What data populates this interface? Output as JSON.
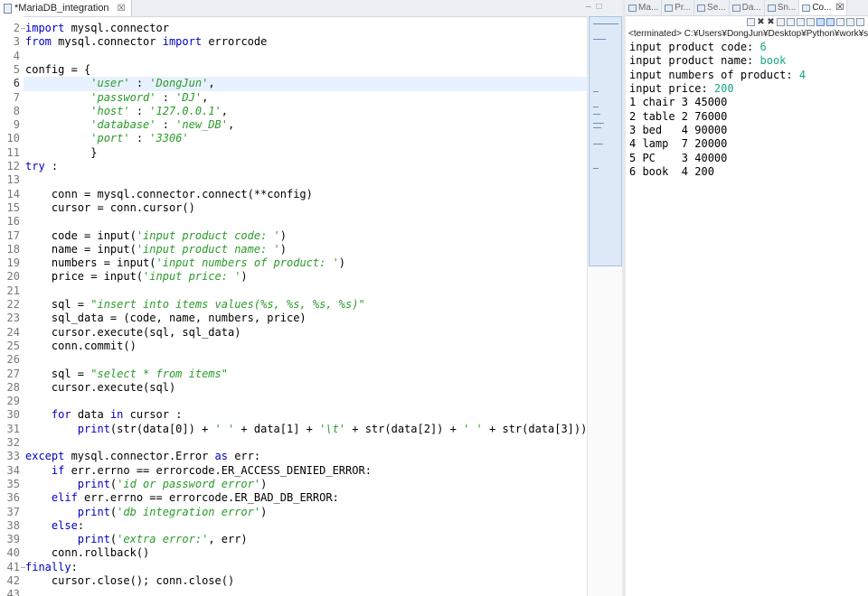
{
  "editor": {
    "tab_title": "*MariaDB_integration",
    "tab_close": "☒",
    "win_min": "–",
    "win_max": "□",
    "lines": [
      {
        "n": "2",
        "fold": "−",
        "segs": [
          {
            "t": "import",
            "c": "kw"
          },
          {
            "t": " mysql.connector"
          }
        ]
      },
      {
        "n": "3",
        "segs": [
          {
            "t": "from",
            "c": "kw"
          },
          {
            "t": " mysql.connector "
          },
          {
            "t": "import",
            "c": "kw"
          },
          {
            "t": " errorcode"
          }
        ]
      },
      {
        "n": "4",
        "segs": []
      },
      {
        "n": "5",
        "segs": [
          {
            "t": "config = {"
          }
        ]
      },
      {
        "n": "6",
        "segs": [
          {
            "t": "          "
          },
          {
            "t": "'user'",
            "c": "st"
          },
          {
            "t": " : "
          },
          {
            "t": "'DongJun'",
            "c": "st"
          },
          {
            "t": ","
          }
        ]
      },
      {
        "n": "7",
        "segs": [
          {
            "t": "          "
          },
          {
            "t": "'password'",
            "c": "st"
          },
          {
            "t": " : "
          },
          {
            "t": "'DJ'",
            "c": "st"
          },
          {
            "t": ","
          }
        ]
      },
      {
        "n": "8",
        "segs": [
          {
            "t": "          "
          },
          {
            "t": "'host'",
            "c": "st"
          },
          {
            "t": " : "
          },
          {
            "t": "'127.0.0.1'",
            "c": "st"
          },
          {
            "t": ","
          }
        ]
      },
      {
        "n": "9",
        "segs": [
          {
            "t": "          "
          },
          {
            "t": "'database'",
            "c": "st"
          },
          {
            "t": " : "
          },
          {
            "t": "'new_DB'",
            "c": "st"
          },
          {
            "t": ","
          }
        ]
      },
      {
        "n": "10",
        "segs": [
          {
            "t": "          "
          },
          {
            "t": "'port'",
            "c": "st"
          },
          {
            "t": " : "
          },
          {
            "t": "'3306'",
            "c": "st"
          }
        ]
      },
      {
        "n": "11",
        "segs": [
          {
            "t": "          }"
          }
        ]
      },
      {
        "n": "12",
        "segs": [
          {
            "t": "try",
            "c": "kw"
          },
          {
            "t": " :"
          }
        ]
      },
      {
        "n": "13",
        "segs": []
      },
      {
        "n": "14",
        "segs": [
          {
            "t": "    conn = mysql.connector.connect(**config)"
          }
        ]
      },
      {
        "n": "15",
        "segs": [
          {
            "t": "    cursor = conn.cursor()"
          }
        ]
      },
      {
        "n": "16",
        "segs": []
      },
      {
        "n": "17",
        "segs": [
          {
            "t": "    code = input("
          },
          {
            "t": "'input product code: '",
            "c": "st"
          },
          {
            "t": ")"
          }
        ]
      },
      {
        "n": "18",
        "segs": [
          {
            "t": "    name = input("
          },
          {
            "t": "'input product name: '",
            "c": "st"
          },
          {
            "t": ")"
          }
        ]
      },
      {
        "n": "19",
        "segs": [
          {
            "t": "    numbers = input("
          },
          {
            "t": "'input numbers of product: '",
            "c": "st"
          },
          {
            "t": ")"
          }
        ]
      },
      {
        "n": "20",
        "segs": [
          {
            "t": "    price = input("
          },
          {
            "t": "'input price: '",
            "c": "st"
          },
          {
            "t": ")"
          }
        ]
      },
      {
        "n": "21",
        "segs": []
      },
      {
        "n": "22",
        "segs": [
          {
            "t": "    sql = "
          },
          {
            "t": "\"insert into items values(%s, %s, %s, %s)\"",
            "c": "st"
          }
        ]
      },
      {
        "n": "23",
        "segs": [
          {
            "t": "    sql_data = (code, name, numbers, price)"
          }
        ]
      },
      {
        "n": "24",
        "segs": [
          {
            "t": "    cursor.execute(sql, sql_data)"
          }
        ]
      },
      {
        "n": "25",
        "segs": [
          {
            "t": "    conn.commit()"
          }
        ]
      },
      {
        "n": "26",
        "segs": []
      },
      {
        "n": "27",
        "segs": [
          {
            "t": "    sql = "
          },
          {
            "t": "\"select * from items\"",
            "c": "st"
          }
        ]
      },
      {
        "n": "28",
        "segs": [
          {
            "t": "    cursor.execute(sql)"
          }
        ]
      },
      {
        "n": "29",
        "segs": []
      },
      {
        "n": "30",
        "segs": [
          {
            "t": "    "
          },
          {
            "t": "for",
            "c": "kw"
          },
          {
            "t": " data "
          },
          {
            "t": "in",
            "c": "kw"
          },
          {
            "t": " cursor :"
          }
        ]
      },
      {
        "n": "31",
        "segs": [
          {
            "t": "        "
          },
          {
            "t": "print",
            "c": "kw"
          },
          {
            "t": "(str(data[0]) + "
          },
          {
            "t": "' '",
            "c": "st"
          },
          {
            "t": " + data[1] + "
          },
          {
            "t": "'\\t'",
            "c": "st"
          },
          {
            "t": " + str(data[2]) + "
          },
          {
            "t": "' '",
            "c": "st"
          },
          {
            "t": " + str(data[3]))"
          }
        ]
      },
      {
        "n": "32",
        "segs": []
      },
      {
        "n": "33",
        "segs": [
          {
            "t": "except",
            "c": "kw"
          },
          {
            "t": " mysql.connector.Error "
          },
          {
            "t": "as",
            "c": "kw"
          },
          {
            "t": " err:"
          }
        ]
      },
      {
        "n": "34",
        "segs": [
          {
            "t": "    "
          },
          {
            "t": "if",
            "c": "kw"
          },
          {
            "t": " err.errno == errorcode.ER_ACCESS_DENIED_ERROR:"
          }
        ]
      },
      {
        "n": "35",
        "segs": [
          {
            "t": "        "
          },
          {
            "t": "print",
            "c": "kw"
          },
          {
            "t": "("
          },
          {
            "t": "'id or password error'",
            "c": "st"
          },
          {
            "t": ")"
          }
        ]
      },
      {
        "n": "36",
        "segs": [
          {
            "t": "    "
          },
          {
            "t": "elif",
            "c": "kw"
          },
          {
            "t": " err.errno == errorcode.ER_BAD_DB_ERROR:"
          }
        ]
      },
      {
        "n": "37",
        "segs": [
          {
            "t": "        "
          },
          {
            "t": "print",
            "c": "kw"
          },
          {
            "t": "("
          },
          {
            "t": "'db integration error'",
            "c": "st"
          },
          {
            "t": ")"
          }
        ]
      },
      {
        "n": "38",
        "segs": [
          {
            "t": "    "
          },
          {
            "t": "else",
            "c": "kw"
          },
          {
            "t": ":"
          }
        ]
      },
      {
        "n": "39",
        "segs": [
          {
            "t": "        "
          },
          {
            "t": "print",
            "c": "kw"
          },
          {
            "t": "("
          },
          {
            "t": "'extra error:'",
            "c": "st"
          },
          {
            "t": ", err)"
          }
        ]
      },
      {
        "n": "40",
        "segs": [
          {
            "t": "    conn.rollback()"
          }
        ]
      },
      {
        "n": "41",
        "fold": "−",
        "segs": [
          {
            "t": "finally",
            "c": "kw"
          },
          {
            "t": ":"
          }
        ]
      },
      {
        "n": "42",
        "segs": [
          {
            "t": "    cursor.close(); conn.close()"
          }
        ]
      },
      {
        "n": "43",
        "segs": []
      }
    ],
    "current_line": "6"
  },
  "console": {
    "tabs": [
      {
        "label": "Ma...",
        "icon": "file-icon",
        "active": false
      },
      {
        "label": "Pr...",
        "icon": "project-icon",
        "active": false
      },
      {
        "label": "Se...",
        "icon": "search-icon",
        "active": false
      },
      {
        "label": "Da...",
        "icon": "database-icon",
        "active": false
      },
      {
        "label": "Sn...",
        "icon": "snippets-icon",
        "active": false
      },
      {
        "label": "Co...",
        "icon": "console-icon",
        "active": true
      }
    ],
    "tab_close": "☒",
    "terminated": "<terminated> C:¥Users¥DongJun¥Desktop¥Python¥work¥sta",
    "lines": [
      {
        "prompt": "input product code: ",
        "value": "6"
      },
      {
        "prompt": "input product name: ",
        "value": "book"
      },
      {
        "prompt": "input numbers of product: ",
        "value": "4"
      },
      {
        "prompt": "input price: ",
        "value": "200"
      },
      {
        "prompt": "1 chair 3 45000",
        "value": ""
      },
      {
        "prompt": "2 table 2 76000",
        "value": ""
      },
      {
        "prompt": "3 bed\t4 90000",
        "value": ""
      },
      {
        "prompt": "4 lamp\t7 20000",
        "value": ""
      },
      {
        "prompt": "5 PC\t3 40000",
        "value": ""
      },
      {
        "prompt": "6 book\t4 200",
        "value": ""
      }
    ]
  }
}
